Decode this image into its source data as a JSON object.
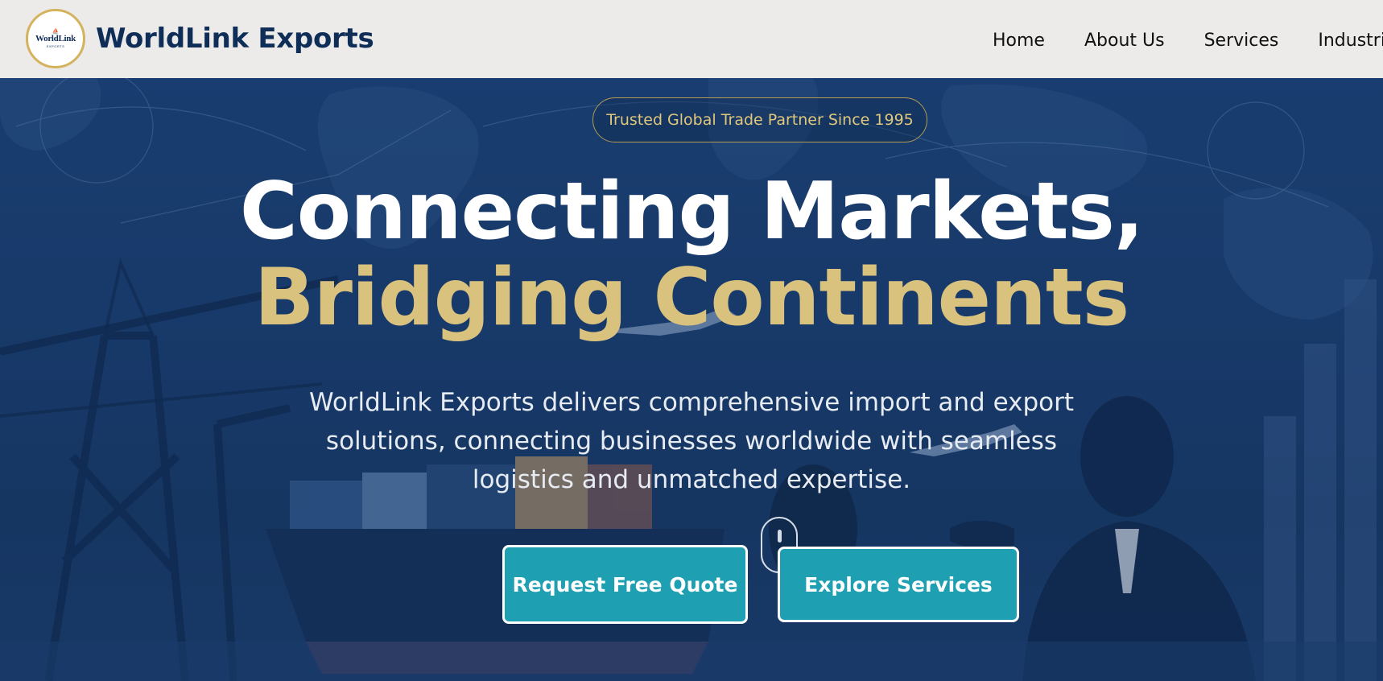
{
  "header": {
    "logo": {
      "mark": "⛵",
      "text": "WorldLink",
      "sub": "EXPORTS"
    },
    "brand_name": "WorldLink Exports",
    "nav": [
      "Home",
      "About Us",
      "Services",
      "Industrie"
    ]
  },
  "hero": {
    "badge": "Trusted Global Trade Partner Since 1995",
    "headline_line1": "Connecting Markets,",
    "headline_line2": "Bridging Continents",
    "subtext": "WorldLink Exports delivers comprehensive import and export solutions, connecting businesses worldwide with seamless logistics and unmatched expertise.",
    "primary_button": "Request Free Quote",
    "secondary_button": "Explore Services"
  },
  "colors": {
    "brand_navy": "#0f2e57",
    "accent_gold": "#d9c17e",
    "button_teal": "#1f9fb2",
    "header_bg": "#ecebea"
  }
}
